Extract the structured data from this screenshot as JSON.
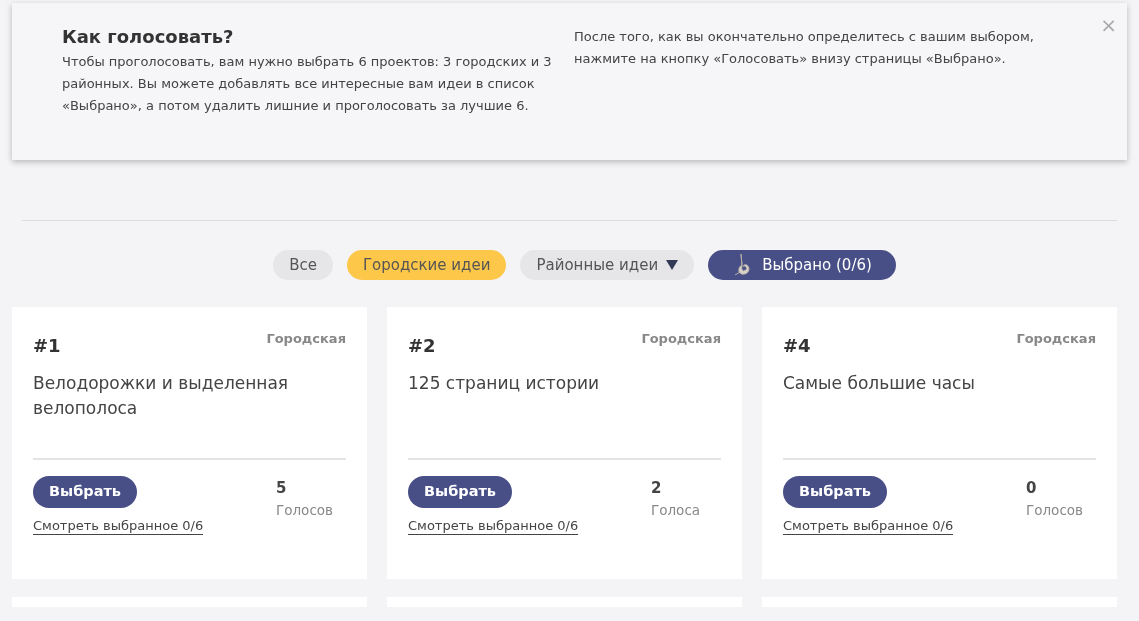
{
  "info": {
    "title": "Как голосовать?",
    "text_left": "Чтобы проголосовать, вам нужно выбрать 6 проектов: 3 городских и 3 районных. Вы можете добавлять все интересные вам идеи в список «Выбрано», а потом удалить лишние и проголосовать за лучшие 6.",
    "text_right": "После того, как вы окончательно определитесь с вашим выбором, нажмите на кнопку «Голосовать» внизу страницы «Выбрано».",
    "close": "×"
  },
  "filters": [
    {
      "label": "Все",
      "kind": "plain",
      "selected": false
    },
    {
      "label": "Городские идеи",
      "kind": "plain",
      "selected": true
    },
    {
      "label": "Районные идеи",
      "kind": "dropdown",
      "selected": false
    },
    {
      "label": "Выбрано (0/6)",
      "kind": "chosen",
      "selected": false
    }
  ],
  "cards": [
    {
      "number": "#1",
      "type": "Городская",
      "title": "Велодорожки и выделенная велополоса",
      "button": "Выбрать",
      "votes": "5",
      "votes_label": "Голосов",
      "link": "Смотреть выбранное 0/6"
    },
    {
      "number": "#2",
      "type": "Городская",
      "title": "125 страниц истории",
      "button": "Выбрать",
      "votes": "2",
      "votes_label": "Голоса",
      "link": "Смотреть выбранное 0/6"
    },
    {
      "number": "#4",
      "type": "Городская",
      "title": "Самые большие часы",
      "button": "Выбрать",
      "votes": "0",
      "votes_label": "Голосов",
      "link": "Смотреть выбранное 0/6"
    }
  ]
}
